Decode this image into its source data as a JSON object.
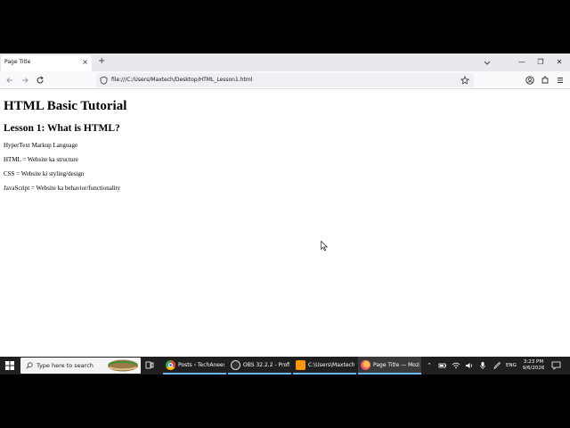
{
  "browser": {
    "tab_title": "Page Title",
    "tab_close": "×",
    "new_tab": "+",
    "url": "file:///C:/Users/Maxtech/Desktop/HTML_Lesson1.html",
    "window_minimize": "—",
    "window_restore": "❐",
    "window_close": "✕"
  },
  "page": {
    "heading": "HTML Basic Tutorial",
    "subheading": "Lesson 1: What is HTML?",
    "paragraphs": [
      "HyperText Markup Language",
      "HTML = Website ka structure",
      "CSS = Website ki styling/design",
      "JavaScript = Website ka behavior/functionality"
    ]
  },
  "taskbar": {
    "search_placeholder": "Type here to search",
    "apps": [
      {
        "label": "Posts ‹ TechAnees ...",
        "icon": "chrome-icon"
      },
      {
        "label": "OBS 32.2.2 - Profil...",
        "icon": "obs-icon"
      },
      {
        "label": "C:\\Users\\Maxtech\\...",
        "icon": "sublime-icon"
      },
      {
        "label": "Page Title — Mozil...",
        "icon": "firefox-icon"
      }
    ],
    "language": "ENG",
    "time": "3:23 PM",
    "date": "9/6/2026"
  }
}
